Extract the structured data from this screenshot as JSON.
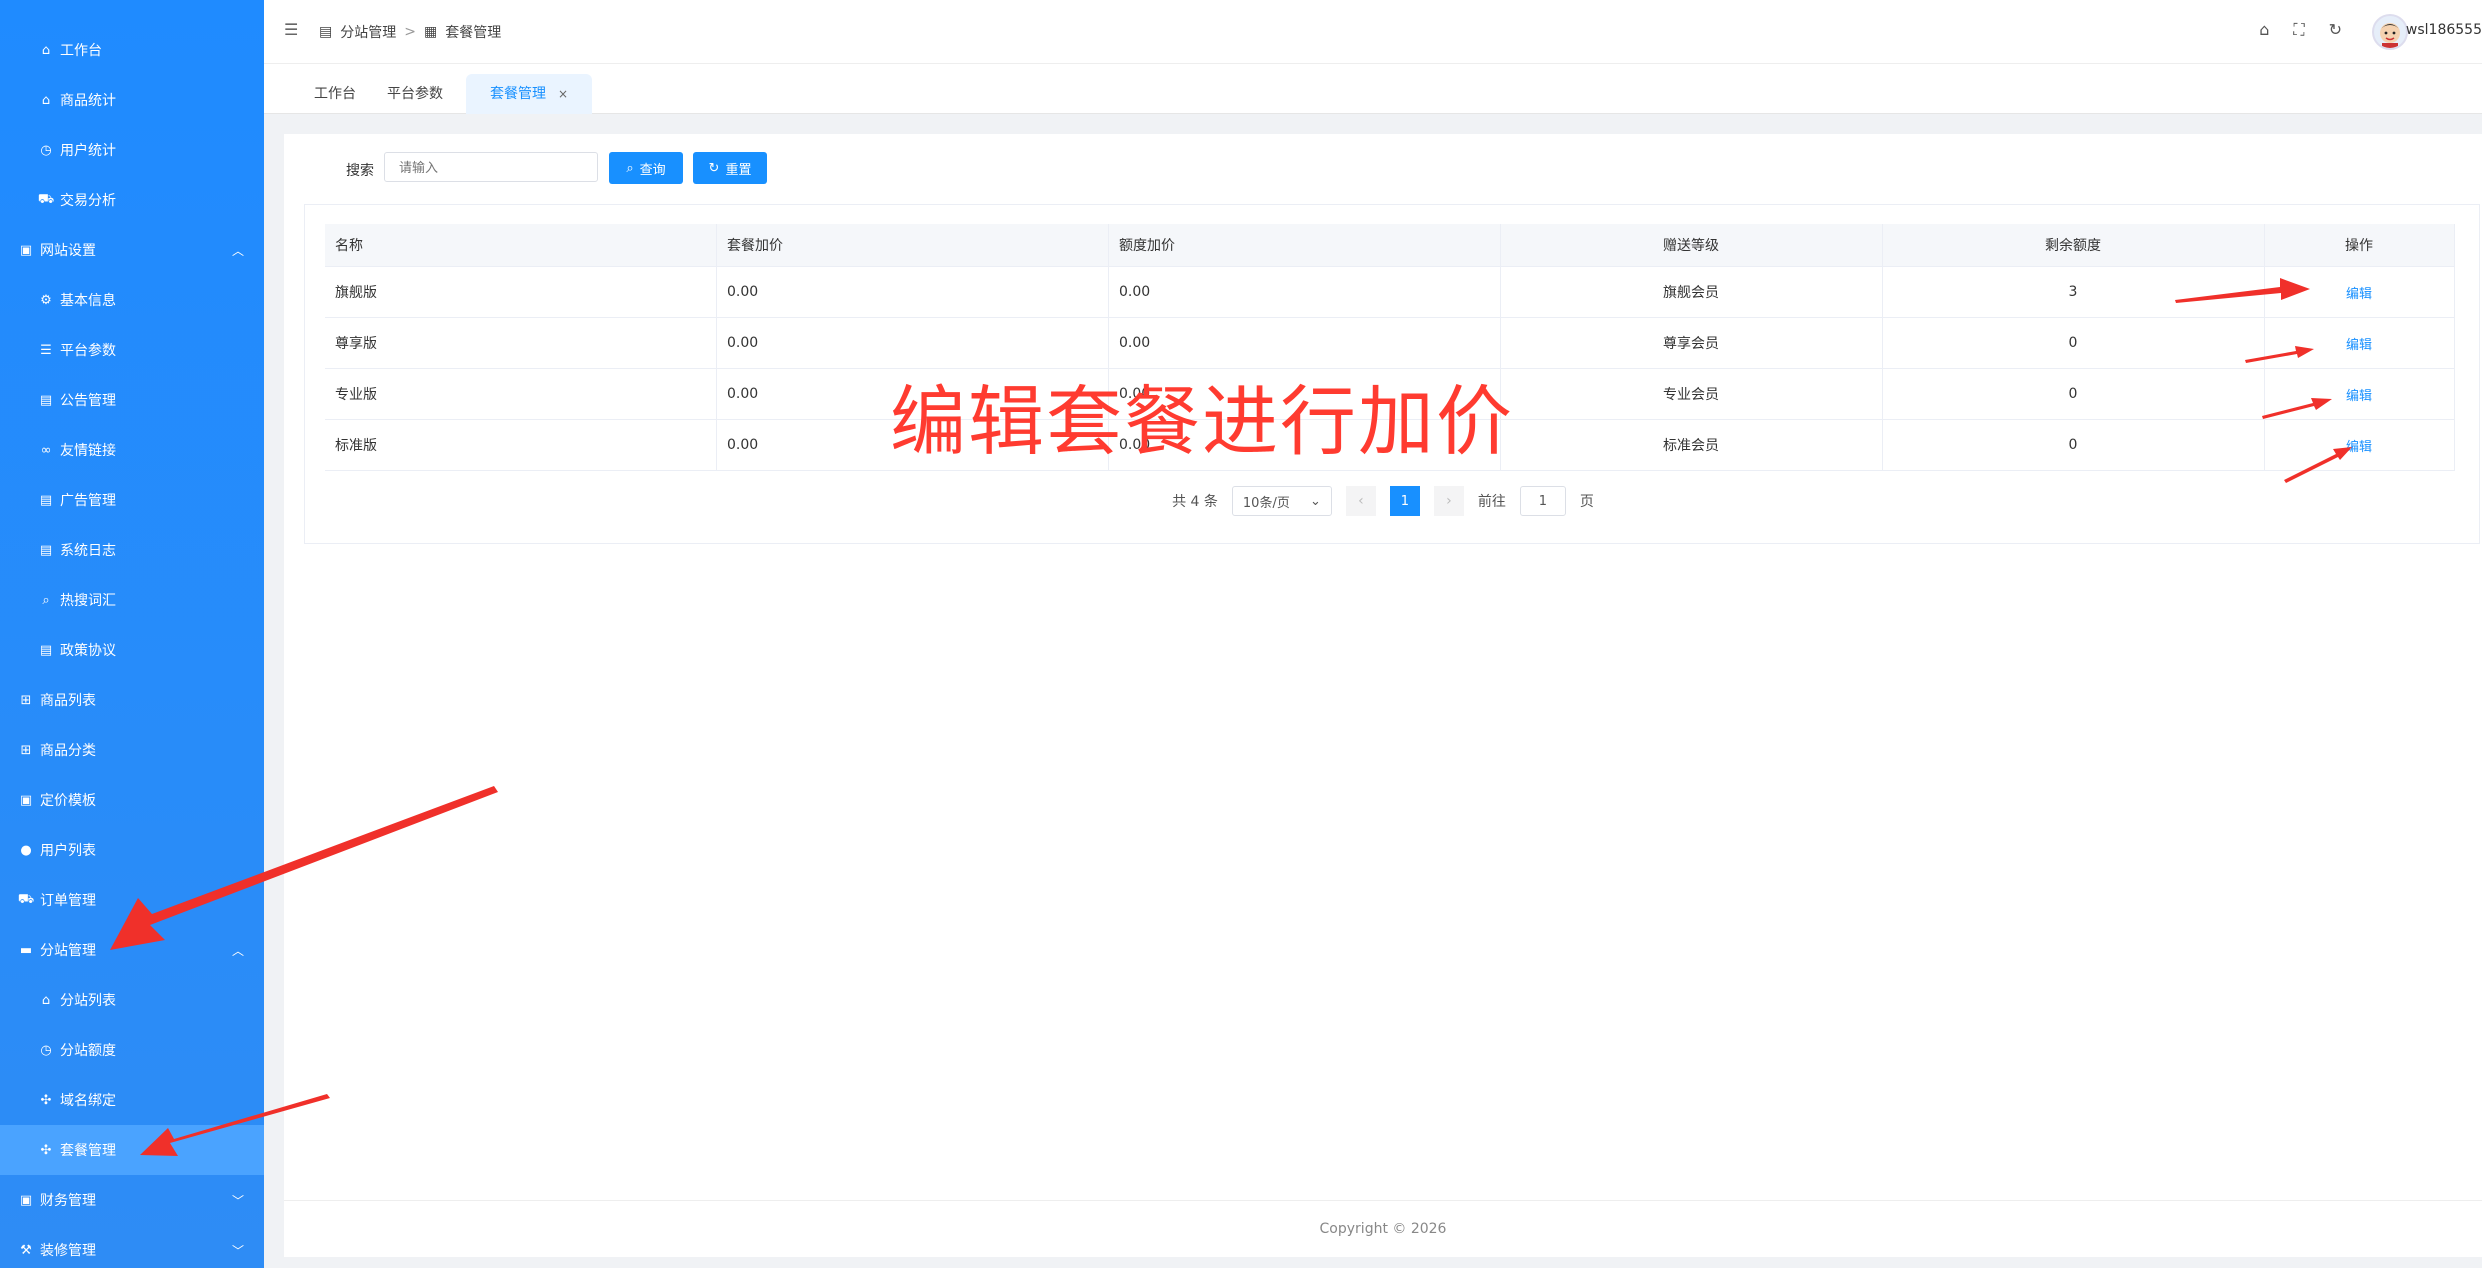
{
  "sidebar": {
    "items": [
      {
        "label": "工作台",
        "icon": "home-icon",
        "level": "sub"
      },
      {
        "label": "商品统计",
        "icon": "store-icon",
        "level": "sub"
      },
      {
        "label": "用户统计",
        "icon": "clock-icon",
        "level": "sub"
      },
      {
        "label": "交易分析",
        "icon": "cart-icon",
        "level": "sub"
      },
      {
        "label": "网站设置",
        "icon": "image-icon",
        "level": "top",
        "chevron": "^"
      },
      {
        "label": "基本信息",
        "icon": "gear-icon",
        "level": "sub"
      },
      {
        "label": "平台参数",
        "icon": "sliders-icon",
        "level": "sub"
      },
      {
        "label": "公告管理",
        "icon": "doc-icon",
        "level": "sub"
      },
      {
        "label": "友情链接",
        "icon": "link-icon",
        "level": "sub"
      },
      {
        "label": "广告管理",
        "icon": "doc-icon",
        "level": "sub"
      },
      {
        "label": "系统日志",
        "icon": "file-icon",
        "level": "sub"
      },
      {
        "label": "热搜词汇",
        "icon": "search-icon",
        "level": "sub"
      },
      {
        "label": "政策协议",
        "icon": "file-icon",
        "level": "sub"
      },
      {
        "label": "商品列表",
        "icon": "grid-icon",
        "level": "top"
      },
      {
        "label": "商品分类",
        "icon": "grid-icon",
        "level": "top"
      },
      {
        "label": "定价模板",
        "icon": "board-icon",
        "level": "top"
      },
      {
        "label": "用户列表",
        "icon": "user-icon",
        "level": "top"
      },
      {
        "label": "订单管理",
        "icon": "cart-icon",
        "level": "top"
      },
      {
        "label": "分站管理",
        "icon": "wallet-icon",
        "level": "top",
        "chevron": "^"
      },
      {
        "label": "分站列表",
        "icon": "store-icon",
        "level": "sub"
      },
      {
        "label": "分站额度",
        "icon": "alarm-icon",
        "level": "sub"
      },
      {
        "label": "域名绑定",
        "icon": "apps-icon",
        "level": "sub"
      },
      {
        "label": "套餐管理",
        "icon": "apps-icon",
        "level": "sub",
        "active": true
      },
      {
        "label": "财务管理",
        "icon": "board-icon",
        "level": "top",
        "chevron": "v"
      },
      {
        "label": "装修管理",
        "icon": "brush-icon",
        "level": "top",
        "chevron": "v"
      }
    ]
  },
  "header": {
    "breadcrumb": [
      "分站管理",
      "套餐管理"
    ],
    "separator": ">",
    "username": "wsl186555"
  },
  "tabs": [
    {
      "label": "工作台"
    },
    {
      "label": "平台参数"
    },
    {
      "label": "套餐管理",
      "active": true,
      "close": "×"
    }
  ],
  "search": {
    "label": "搜索",
    "placeholder": "请输入",
    "query_label": "查询",
    "reset_label": "重置"
  },
  "table": {
    "columns": [
      "名称",
      "套餐加价",
      "额度加价",
      "赠送等级",
      "剩余额度",
      "操作"
    ],
    "rows": [
      [
        "旗舰版",
        "0.00",
        "0.00",
        "旗舰会员",
        "3",
        "编辑"
      ],
      [
        "尊享版",
        "0.00",
        "0.00",
        "尊享会员",
        "0",
        "编辑"
      ],
      [
        "专业版",
        "0.00",
        "0.00",
        "专业会员",
        "0",
        "编辑"
      ],
      [
        "标准版",
        "0.00",
        "0.00",
        "标准会员",
        "0",
        "编辑"
      ]
    ]
  },
  "pager": {
    "total": "共 4 条",
    "size": "10条/页",
    "prev": "‹",
    "current": "1",
    "next": "›",
    "goto_label": "前往",
    "goto_value": "1",
    "page_unit": "页"
  },
  "annotation": {
    "text": "编辑套餐进行加价",
    "color": "#ff3b30"
  },
  "footer": {
    "copyright": "Copyright © 2026"
  },
  "colors": {
    "primary": "#1890ff",
    "sidebar": "#1f8bff",
    "active_item": "#4aa3ff"
  }
}
